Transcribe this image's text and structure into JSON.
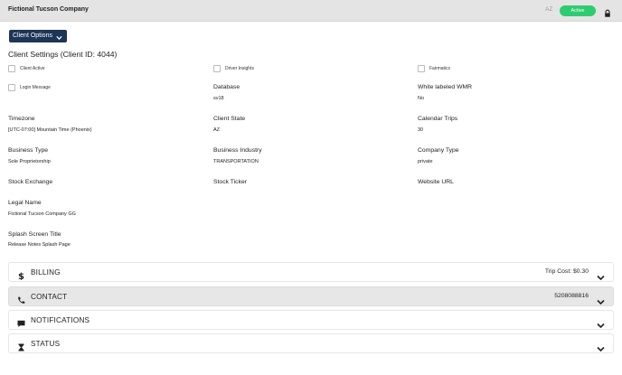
{
  "header": {
    "company_name": "Fictional Tucson Company",
    "state_code": "AZ",
    "status_label": "Active"
  },
  "toolbar": {
    "client_options_label": "Client Options"
  },
  "settings": {
    "title": "Client Settings (Client ID: 4044)",
    "checkboxes": [
      {
        "label": "Client Active",
        "checked": false
      },
      {
        "label": "Driver Insights",
        "checked": false
      },
      {
        "label": "Fairmatics",
        "checked": false
      },
      {
        "label": "Login Message",
        "checked": false
      }
    ],
    "fields": {
      "database": {
        "label": "Database",
        "value": "sv18"
      },
      "white_label": {
        "label": "White labeled WMR",
        "value": "No"
      },
      "timezone": {
        "label": "Timezone",
        "value": "[UTC-07:00] Mountain Time (Phoenix)"
      },
      "client_state": {
        "label": "Client State",
        "value": "AZ"
      },
      "calendar_trips": {
        "label": "Calendar Trips",
        "value": "30"
      },
      "business_type": {
        "label": "Business Type",
        "value": "Sole Proprietorship"
      },
      "business_industry": {
        "label": "Business Industry",
        "value": "TRANSPORTATION"
      },
      "company_type": {
        "label": "Company Type",
        "value": "private"
      },
      "stock_exchange": {
        "label": "Stock Exchange",
        "value": ""
      },
      "stock_ticker": {
        "label": "Stock Ticker",
        "value": ""
      },
      "website_url": {
        "label": "Website URL",
        "value": ""
      },
      "legal_name": {
        "label": "Legal Name",
        "value": "Fictional Tucson Company GG"
      },
      "splash_title": {
        "label": "Splash Screen Title",
        "value": "Release Notes Splash Page"
      }
    }
  },
  "panels": [
    {
      "title": "BILLING",
      "icon": "dollar-icon",
      "extra": "Trip Cost: $0.30"
    },
    {
      "title": "CONTACT",
      "icon": "phone-icon",
      "extra": "5208088816"
    },
    {
      "title": "NOTIFICATIONS",
      "icon": "comment-icon",
      "extra": ""
    },
    {
      "title": "STATUS",
      "icon": "hourglass-icon",
      "extra": ""
    }
  ],
  "colors": {
    "accent": "#1d3557",
    "active": "#2ecc71",
    "header_bg": "#e4e4e4",
    "panel_shaded": "#e7e7e7"
  }
}
